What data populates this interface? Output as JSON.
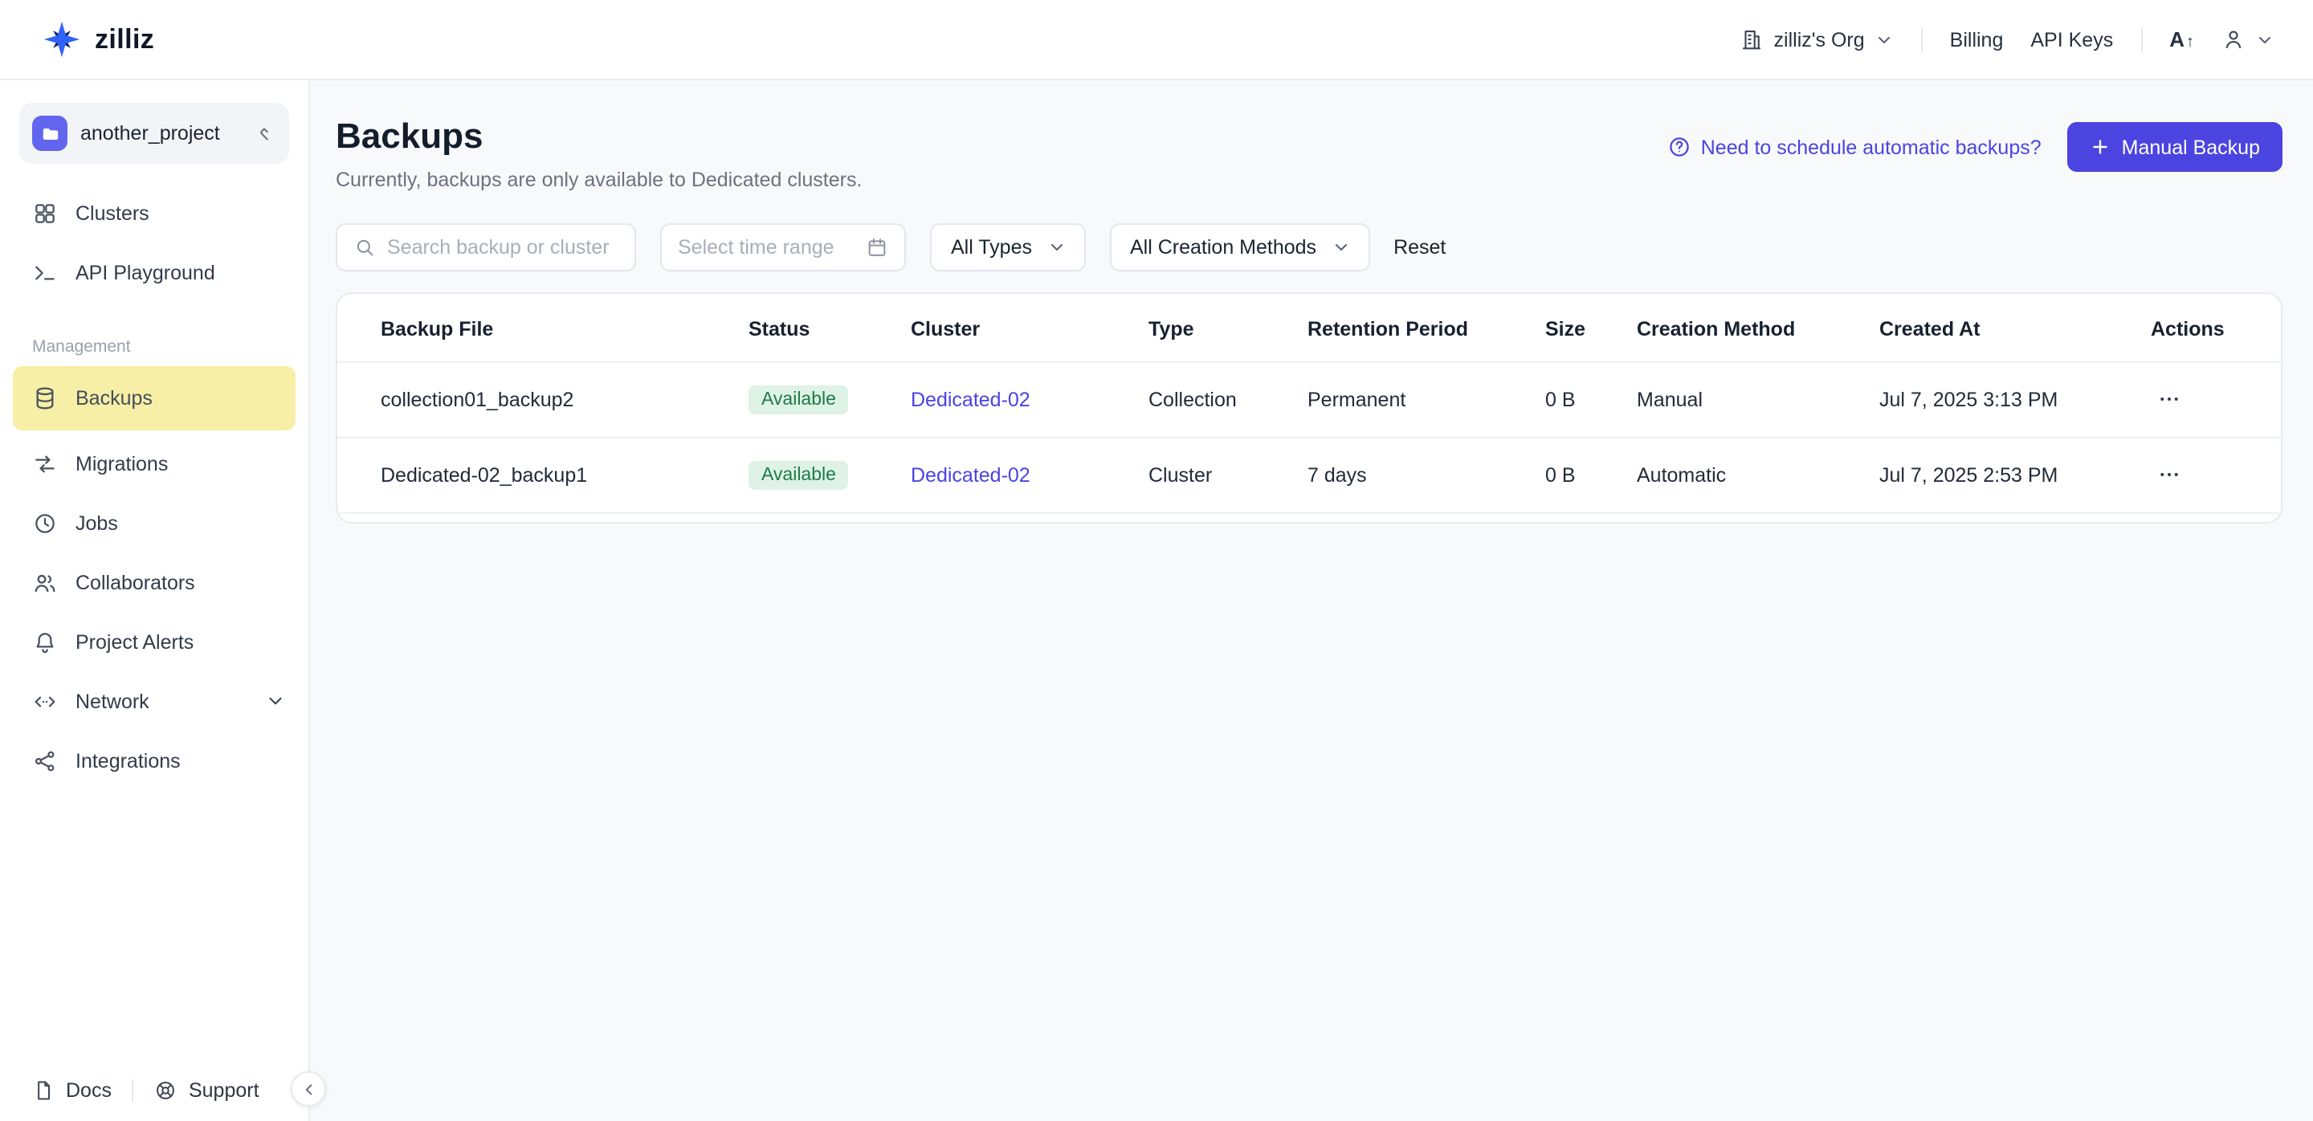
{
  "topbar": {
    "brand": "zilliz",
    "org": "zilliz's Org",
    "billing": "Billing",
    "api_keys": "API Keys"
  },
  "sidebar": {
    "project": "another_project",
    "items": [
      {
        "label": "Clusters"
      },
      {
        "label": "API Playground"
      }
    ],
    "section": "Management",
    "management_items": [
      {
        "label": "Backups"
      },
      {
        "label": "Migrations"
      },
      {
        "label": "Jobs"
      },
      {
        "label": "Collaborators"
      },
      {
        "label": "Project Alerts"
      },
      {
        "label": "Network"
      },
      {
        "label": "Integrations"
      }
    ],
    "docs": "Docs",
    "support": "Support"
  },
  "page": {
    "title": "Backups",
    "subtitle": "Currently, backups are only available to Dedicated clusters.",
    "schedule_link": "Need to schedule automatic backups?",
    "manual_backup": "Manual Backup"
  },
  "filters": {
    "search_placeholder": "Search backup or cluster",
    "time_placeholder": "Select time range",
    "type_filter": "All Types",
    "creation_filter": "All Creation Methods",
    "reset": "Reset"
  },
  "table": {
    "columns": [
      "Backup File",
      "Status",
      "Cluster",
      "Type",
      "Retention Period",
      "Size",
      "Creation Method",
      "Created At",
      "Actions"
    ],
    "rows": [
      {
        "file": "collection01_backup2",
        "status": "Available",
        "cluster": "Dedicated-02",
        "type": "Collection",
        "retention": "Permanent",
        "size": "0 B",
        "method": "Manual",
        "created": "Jul 7, 2025 3:13 PM"
      },
      {
        "file": "Dedicated-02_backup1",
        "status": "Available",
        "cluster": "Dedicated-02",
        "type": "Cluster",
        "retention": "7 days",
        "size": "0 B",
        "method": "Automatic",
        "created": "Jul 7, 2025 2:53 PM"
      }
    ]
  },
  "colors": {
    "accent": "#4b44e0",
    "sidebar_highlight": "#f6efa5",
    "status_bg": "#def2e6",
    "status_text": "#1e7a48"
  }
}
